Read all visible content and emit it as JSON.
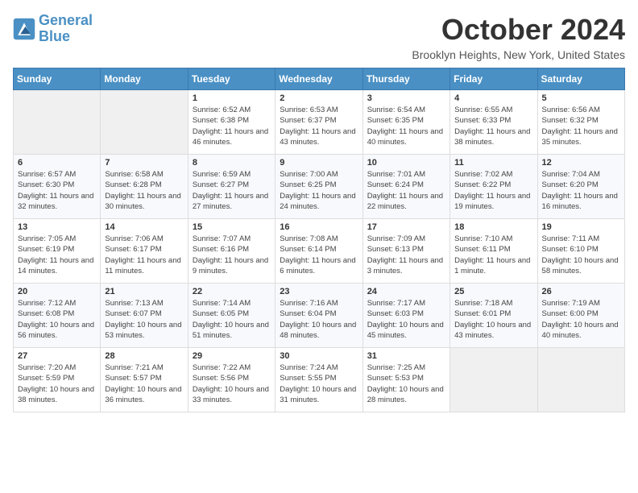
{
  "logo": {
    "line1": "General",
    "line2": "Blue"
  },
  "title": "October 2024",
  "location": "Brooklyn Heights, New York, United States",
  "weekdays": [
    "Sunday",
    "Monday",
    "Tuesday",
    "Wednesday",
    "Thursday",
    "Friday",
    "Saturday"
  ],
  "weeks": [
    [
      {
        "day": "",
        "info": ""
      },
      {
        "day": "",
        "info": ""
      },
      {
        "day": "1",
        "info": "Sunrise: 6:52 AM\nSunset: 6:38 PM\nDaylight: 11 hours and 46 minutes."
      },
      {
        "day": "2",
        "info": "Sunrise: 6:53 AM\nSunset: 6:37 PM\nDaylight: 11 hours and 43 minutes."
      },
      {
        "day": "3",
        "info": "Sunrise: 6:54 AM\nSunset: 6:35 PM\nDaylight: 11 hours and 40 minutes."
      },
      {
        "day": "4",
        "info": "Sunrise: 6:55 AM\nSunset: 6:33 PM\nDaylight: 11 hours and 38 minutes."
      },
      {
        "day": "5",
        "info": "Sunrise: 6:56 AM\nSunset: 6:32 PM\nDaylight: 11 hours and 35 minutes."
      }
    ],
    [
      {
        "day": "6",
        "info": "Sunrise: 6:57 AM\nSunset: 6:30 PM\nDaylight: 11 hours and 32 minutes."
      },
      {
        "day": "7",
        "info": "Sunrise: 6:58 AM\nSunset: 6:28 PM\nDaylight: 11 hours and 30 minutes."
      },
      {
        "day": "8",
        "info": "Sunrise: 6:59 AM\nSunset: 6:27 PM\nDaylight: 11 hours and 27 minutes."
      },
      {
        "day": "9",
        "info": "Sunrise: 7:00 AM\nSunset: 6:25 PM\nDaylight: 11 hours and 24 minutes."
      },
      {
        "day": "10",
        "info": "Sunrise: 7:01 AM\nSunset: 6:24 PM\nDaylight: 11 hours and 22 minutes."
      },
      {
        "day": "11",
        "info": "Sunrise: 7:02 AM\nSunset: 6:22 PM\nDaylight: 11 hours and 19 minutes."
      },
      {
        "day": "12",
        "info": "Sunrise: 7:04 AM\nSunset: 6:20 PM\nDaylight: 11 hours and 16 minutes."
      }
    ],
    [
      {
        "day": "13",
        "info": "Sunrise: 7:05 AM\nSunset: 6:19 PM\nDaylight: 11 hours and 14 minutes."
      },
      {
        "day": "14",
        "info": "Sunrise: 7:06 AM\nSunset: 6:17 PM\nDaylight: 11 hours and 11 minutes."
      },
      {
        "day": "15",
        "info": "Sunrise: 7:07 AM\nSunset: 6:16 PM\nDaylight: 11 hours and 9 minutes."
      },
      {
        "day": "16",
        "info": "Sunrise: 7:08 AM\nSunset: 6:14 PM\nDaylight: 11 hours and 6 minutes."
      },
      {
        "day": "17",
        "info": "Sunrise: 7:09 AM\nSunset: 6:13 PM\nDaylight: 11 hours and 3 minutes."
      },
      {
        "day": "18",
        "info": "Sunrise: 7:10 AM\nSunset: 6:11 PM\nDaylight: 11 hours and 1 minute."
      },
      {
        "day": "19",
        "info": "Sunrise: 7:11 AM\nSunset: 6:10 PM\nDaylight: 10 hours and 58 minutes."
      }
    ],
    [
      {
        "day": "20",
        "info": "Sunrise: 7:12 AM\nSunset: 6:08 PM\nDaylight: 10 hours and 56 minutes."
      },
      {
        "day": "21",
        "info": "Sunrise: 7:13 AM\nSunset: 6:07 PM\nDaylight: 10 hours and 53 minutes."
      },
      {
        "day": "22",
        "info": "Sunrise: 7:14 AM\nSunset: 6:05 PM\nDaylight: 10 hours and 51 minutes."
      },
      {
        "day": "23",
        "info": "Sunrise: 7:16 AM\nSunset: 6:04 PM\nDaylight: 10 hours and 48 minutes."
      },
      {
        "day": "24",
        "info": "Sunrise: 7:17 AM\nSunset: 6:03 PM\nDaylight: 10 hours and 45 minutes."
      },
      {
        "day": "25",
        "info": "Sunrise: 7:18 AM\nSunset: 6:01 PM\nDaylight: 10 hours and 43 minutes."
      },
      {
        "day": "26",
        "info": "Sunrise: 7:19 AM\nSunset: 6:00 PM\nDaylight: 10 hours and 40 minutes."
      }
    ],
    [
      {
        "day": "27",
        "info": "Sunrise: 7:20 AM\nSunset: 5:59 PM\nDaylight: 10 hours and 38 minutes."
      },
      {
        "day": "28",
        "info": "Sunrise: 7:21 AM\nSunset: 5:57 PM\nDaylight: 10 hours and 36 minutes."
      },
      {
        "day": "29",
        "info": "Sunrise: 7:22 AM\nSunset: 5:56 PM\nDaylight: 10 hours and 33 minutes."
      },
      {
        "day": "30",
        "info": "Sunrise: 7:24 AM\nSunset: 5:55 PM\nDaylight: 10 hours and 31 minutes."
      },
      {
        "day": "31",
        "info": "Sunrise: 7:25 AM\nSunset: 5:53 PM\nDaylight: 10 hours and 28 minutes."
      },
      {
        "day": "",
        "info": ""
      },
      {
        "day": "",
        "info": ""
      }
    ]
  ]
}
